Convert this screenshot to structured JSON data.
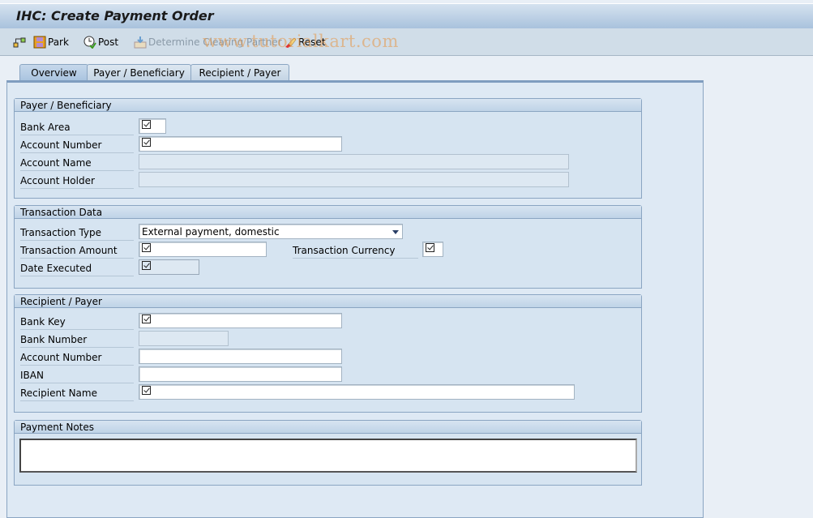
{
  "window": {
    "title": "IHC: Create Payment Order"
  },
  "toolbar": {
    "items": [
      {
        "icon": "other-object-icon",
        "label": ""
      },
      {
        "icon": "save-icon",
        "label": "Park"
      },
      {
        "icon": "post-icon",
        "label": "Post"
      },
      {
        "icon": "determine-icon",
        "label": "Determine Clearing Partner",
        "disabled": true
      },
      {
        "icon": "eraser-icon",
        "label": "Reset"
      }
    ],
    "watermark": "www.tutorialkart.com"
  },
  "tabs": [
    {
      "label": "Overview",
      "active": true
    },
    {
      "label": "Payer / Beneficiary",
      "active": false
    },
    {
      "label": "Recipient / Payer",
      "active": false
    }
  ],
  "groups": {
    "payer": {
      "title": "Payer / Beneficiary",
      "fields": [
        {
          "label": "Bank Area",
          "value": "",
          "required": true,
          "readonly": false
        },
        {
          "label": "Account Number",
          "value": "",
          "required": true,
          "readonly": false
        },
        {
          "label": "Account Name",
          "value": "",
          "required": false,
          "readonly": true
        },
        {
          "label": "Account Holder",
          "value": "",
          "required": false,
          "readonly": true
        }
      ]
    },
    "transaction": {
      "title": "Transaction Data",
      "type_label": "Transaction Type",
      "type_value": "External payment, domestic",
      "amount_label": "Transaction Amount",
      "currency_label": "Transaction Currency",
      "date_label": "Date Executed"
    },
    "recipient": {
      "title": "Recipient / Payer",
      "fields": [
        {
          "label": "Bank Key",
          "required": true,
          "readonly": false
        },
        {
          "label": "Bank Number",
          "required": false,
          "readonly": true
        },
        {
          "label": "Account Number",
          "required": false,
          "readonly": false
        },
        {
          "label": "IBAN",
          "required": false,
          "readonly": false
        },
        {
          "label": "Recipient Name",
          "required": true,
          "readonly": false
        }
      ]
    },
    "notes": {
      "title": "Payment Notes",
      "value": ""
    }
  }
}
